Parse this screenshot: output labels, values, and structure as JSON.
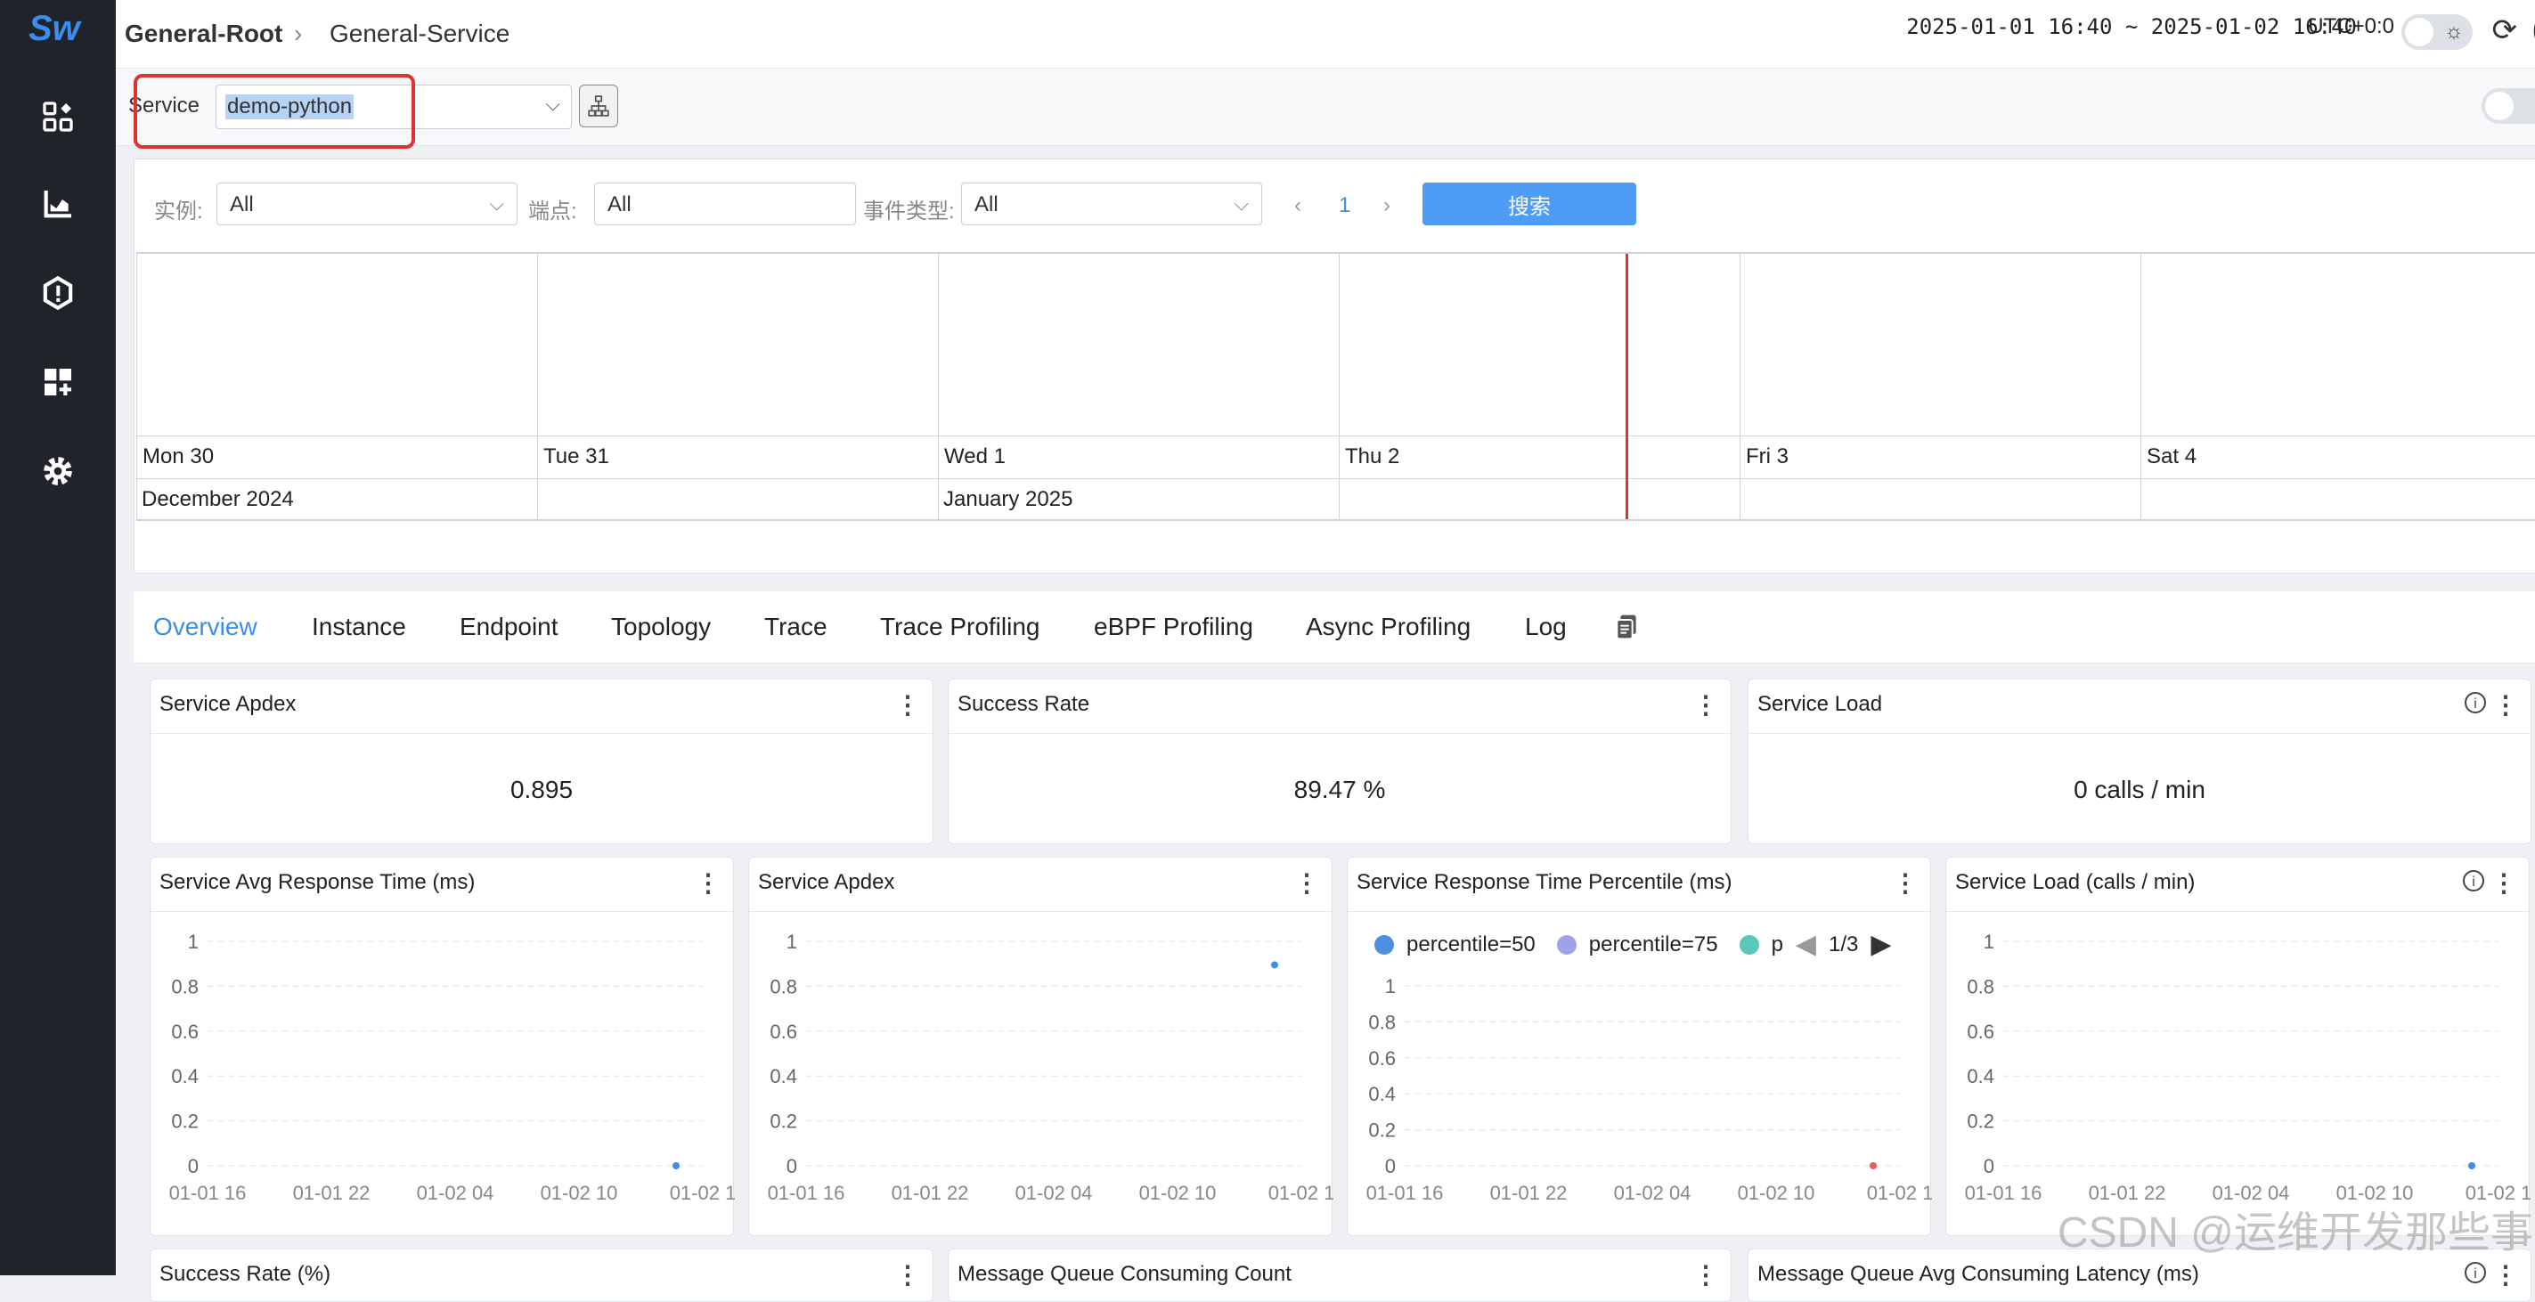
{
  "header": {
    "breadcrumb_root": "General-Root",
    "breadcrumb_current": "General-Service",
    "time_range": "2025-01-01 16:40 ~ 2025-01-02 16:40",
    "timezone": "UTC+0:0"
  },
  "selector": {
    "label": "Service",
    "value": "demo-python"
  },
  "filters": {
    "instance_label": "实例:",
    "instance_value": "All",
    "endpoint_label": "端点:",
    "endpoint_value": "All",
    "event_type_label": "事件类型:",
    "event_type_value": "All",
    "page": "1",
    "search_label": "搜索"
  },
  "timeline": {
    "days": [
      "Mon 30",
      "Tue 31",
      "Wed 1",
      "Thu 2",
      "Fri 3",
      "Sat 4"
    ],
    "months": [
      "December 2024",
      "January 2025"
    ]
  },
  "tabs": [
    "Overview",
    "Instance",
    "Endpoint",
    "Topology",
    "Trace",
    "Trace Profiling",
    "eBPF Profiling",
    "Async Profiling",
    "Log"
  ],
  "active_tab": "Overview",
  "cards_top": [
    {
      "title": "Service Apdex",
      "value": "0.895"
    },
    {
      "title": "Success Rate",
      "value": "89.47 %"
    },
    {
      "title": "Service Load",
      "value": "0 calls / min"
    }
  ],
  "charts": [
    {
      "title": "Service Avg Response Time (ms)"
    },
    {
      "title": "Service Apdex"
    },
    {
      "title": "Service Response Time Percentile (ms)",
      "legend": [
        "percentile=50",
        "percentile=75",
        "p"
      ],
      "legend_page": "1/3"
    },
    {
      "title": "Service Load (calls / min)"
    }
  ],
  "cards_bottom": [
    {
      "title": "Success Rate (%)"
    },
    {
      "title": "Message Queue Consuming Count"
    },
    {
      "title": "Message Queue Avg Consuming Latency (ms)"
    }
  ],
  "colors": {
    "accent": "#3a8ee6",
    "sidebar": "#20242a",
    "highlight": "#e0322f",
    "p50": "#4e8fe0",
    "p75": "#9fa3e6",
    "p90": "#5cc6b9"
  },
  "chart_data": [
    {
      "type": "scatter",
      "title": "Service Avg Response Time (ms)",
      "x": [
        "01-01 16",
        "01-01 22",
        "01-02 04",
        "01-02 10",
        "01-02 1"
      ],
      "ylim": [
        0,
        1
      ],
      "yticks": [
        "1",
        "0.8",
        "0.6",
        "0.4",
        "0.2",
        "0"
      ],
      "points": [
        {
          "x": "01-02 16",
          "y": 0
        }
      ]
    },
    {
      "type": "scatter",
      "title": "Service Apdex",
      "x": [
        "01-01 16",
        "01-01 22",
        "01-02 04",
        "01-02 10",
        "01-02 1"
      ],
      "ylim": [
        0,
        1
      ],
      "yticks": [
        "1",
        "0.8",
        "0.6",
        "0.4",
        "0.2",
        "0"
      ],
      "points": [
        {
          "x": "01-02 16",
          "y": 0.895
        }
      ]
    },
    {
      "type": "scatter",
      "title": "Service Response Time Percentile (ms)",
      "x": [
        "01-01 16",
        "01-01 22",
        "01-02 04",
        "01-02 10",
        "01-02 1"
      ],
      "ylim": [
        0,
        1
      ],
      "yticks": [
        "1",
        "0.8",
        "0.6",
        "0.4",
        "0.2",
        "0"
      ],
      "points": [
        {
          "x": "01-02 16",
          "y": 0
        }
      ]
    },
    {
      "type": "scatter",
      "title": "Service Load (calls / min)",
      "x": [
        "01-01 16",
        "01-01 22",
        "01-02 04",
        "01-02 10",
        "01-02 1"
      ],
      "ylim": [
        0,
        1
      ],
      "yticks": [
        "1",
        "0.8",
        "0.6",
        "0.4",
        "0.2",
        "0"
      ],
      "points": [
        {
          "x": "01-02 16",
          "y": 0
        }
      ]
    }
  ],
  "watermark": "CSDN @运维开发那些事"
}
